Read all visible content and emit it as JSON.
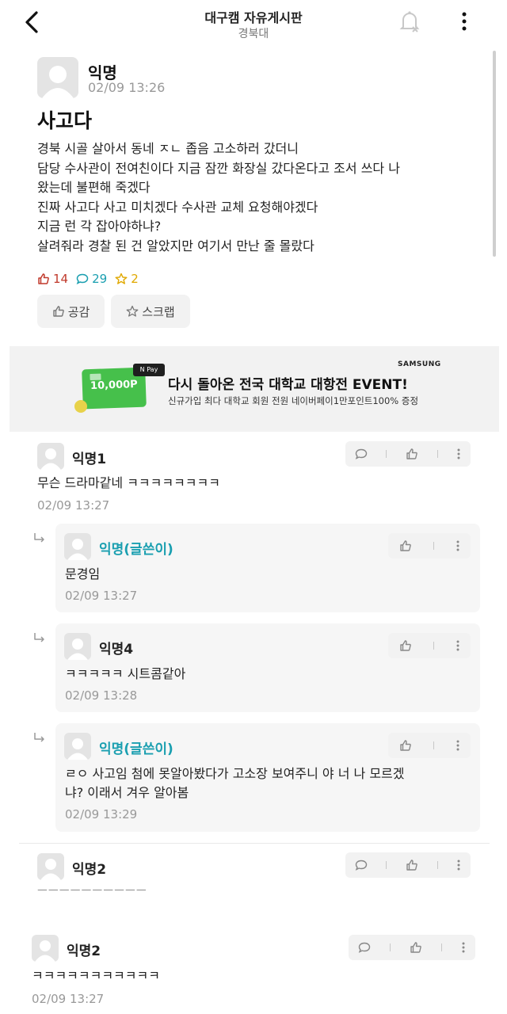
{
  "header": {
    "title": "대구캠 자유게시판",
    "subtitle": "경북대"
  },
  "post": {
    "author": "익명",
    "time": "02/09 13:26",
    "title": "사고다",
    "body_lines": [
      "경북 시골 살아서 동네 ㅈㄴ 좁음  고소하러 갔더니",
      "담당 수사관이 전여친이다 지금 잠깐 화장실 갔다온다고 조서 쓰다 나",
      "왔는데 불편해 죽겠다",
      "진짜 사고다 사고 미치겠다 수사관 교체 요청해야겠다",
      "지금 런 각 잡아야하냐?",
      "살려줘라 경찰 된 건 알았지만 여기서 만난 줄 몰랐다"
    ],
    "stats": {
      "likes": "14",
      "comments": "29",
      "scraps": "2"
    },
    "like_button": "공감",
    "scrap_button": "스크랩"
  },
  "ad": {
    "brand": "SAMSUNG",
    "npay": "N Pay",
    "card_amount": "10,000P",
    "title": "다시 돌아온 전국 대학교 대항전 EVENT!",
    "desc": "신규가입 최다 대학교 회원 전원 네이버페이1만포인트100% 증정"
  },
  "comments": [
    {
      "author": "익명1",
      "text": "무슨 드라마같네 ㅋㅋㅋㅋㅋㅋㅋㅋ",
      "time": "02/09 13:27"
    },
    {
      "author": "익명(글쓴이)",
      "text": "문경임",
      "time": "02/09 13:27"
    },
    {
      "author": "익명4",
      "text": "ㅋㅋㅋㅋㅋ 시트콤같아",
      "time": "02/09 13:28"
    },
    {
      "author": "익명(글쓴이)",
      "text_lines": [
        "ㄹㅇ 사고임 첨에 못알아봤다가 고소장 보여주니 야 너 나 모르겠",
        "냐? 이래서 겨우 알아봄"
      ],
      "time": "02/09 13:29"
    },
    {
      "author": "익명2",
      "text": "ㅡㅡㅡㅡㅡㅡㅡㅡㅡㅡ"
    },
    {
      "author": "익명2",
      "text": "ㅋㅋㅋㅋㅋㅋㅋㅋㅋㅋㅋ",
      "time": "02/09 13:27"
    }
  ],
  "colors": {
    "accent": "#1a9fb0",
    "like": "#c0392b",
    "scrap": "#e0a800",
    "ad_green": "#46c04b"
  }
}
